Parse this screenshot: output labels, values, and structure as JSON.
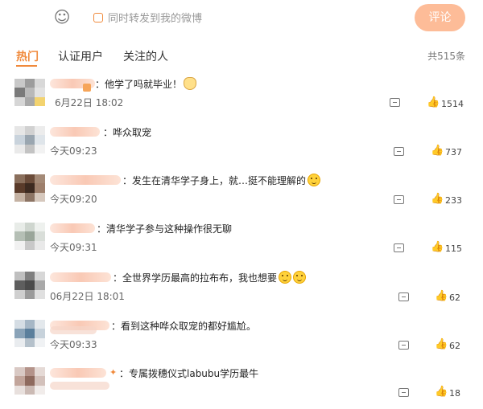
{
  "composer": {
    "emoji_icon": "smiley-icon",
    "repost_label": "同时转发到我的微博",
    "submit_label": "评论"
  },
  "tabs": {
    "hot": "热门",
    "verified": "认证用户",
    "following": "关注的人",
    "total": "共515条"
  },
  "colors": {
    "accent": "#f08a3c",
    "button": "#fdbc98"
  },
  "comments": [
    {
      "text": "：他学了吗就毕业！",
      "emoji": "cat-emoji",
      "time": "6月22日 18:02",
      "likes": "1514"
    },
    {
      "text": "：哗众取宠",
      "emoji": "",
      "time": "今天09:23",
      "likes": "737"
    },
    {
      "text": "：发生在清华学子身上，就…挺不能理解的",
      "emoji": "smiley-emoji",
      "time": "今天09:20",
      "likes": "233"
    },
    {
      "text": "：清华学子参与这种操作很无聊",
      "emoji": "",
      "time": "今天09:31",
      "likes": "115"
    },
    {
      "text": "：全世界学历最高的拉布布，我也想要",
      "emoji": "tongue-emoji",
      "time": "06月22日 18:01",
      "likes": "62"
    },
    {
      "text": "：看到这种哗众取宠的都好尴尬。",
      "emoji": "",
      "time": "今天09:33",
      "likes": "62"
    },
    {
      "text": "：专属拨穗仪式labubu学历最牛",
      "emoji": "",
      "time": "",
      "likes": "18"
    }
  ]
}
